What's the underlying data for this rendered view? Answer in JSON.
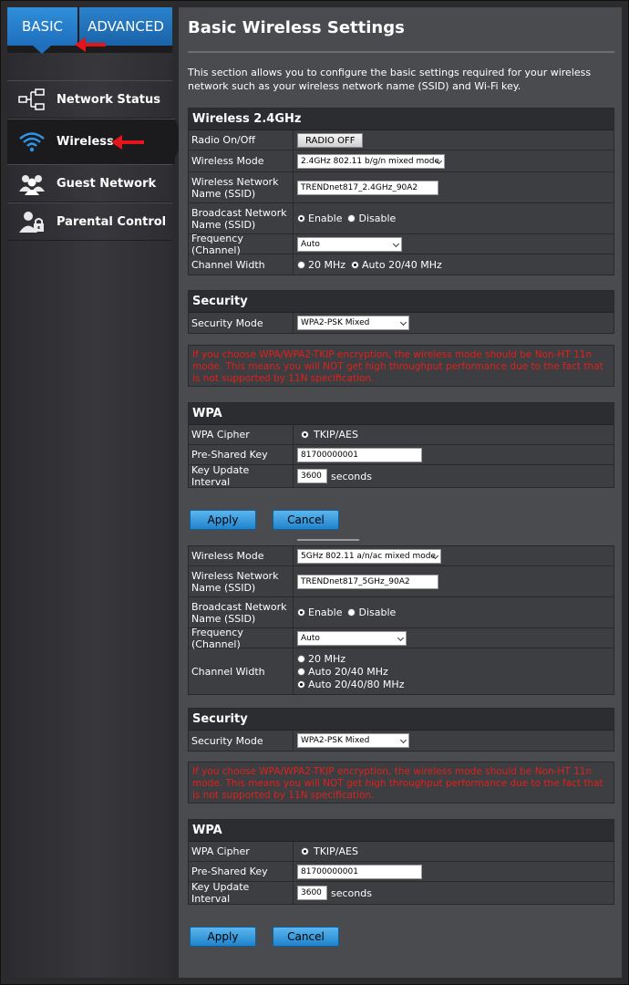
{
  "tabs": {
    "basic": "BASIC",
    "advanced": "ADVANCED"
  },
  "nav": [
    {
      "label": "Network Status",
      "icon": "network-tree-icon"
    },
    {
      "label": "Wireless",
      "icon": "wifi-icon",
      "active": true
    },
    {
      "label": "Guest Network",
      "icon": "users-icon"
    },
    {
      "label": "Parental Control",
      "icon": "user-lock-icon"
    }
  ],
  "page": {
    "title": "Basic Wireless Settings",
    "intro": "This section allows you to configure the basic settings required for your wireless network such as your wireless network name (SSID) and Wi-Fi key."
  },
  "w24": {
    "header": "Wireless 2.4GHz",
    "radio_label": "Radio On/Off",
    "radio_button": "RADIO OFF",
    "mode_label": "Wireless Mode",
    "mode_value": "2.4GHz 802.11 b/g/n mixed mode",
    "ssid_label": "Wireless Network Name (SSID)",
    "ssid_value": "TRENDnet817_2.4GHz_90A2",
    "broadcast_label": "Broadcast Network Name (SSID)",
    "enable": "Enable",
    "disable": "Disable",
    "freq_label": "Frequency (Channel)",
    "freq_value": "Auto",
    "width_label": "Channel Width",
    "width_20": "20 MHz",
    "width_auto": "Auto 20/40 MHz"
  },
  "sec1": {
    "header": "Security",
    "mode_label": "Security Mode",
    "mode_value": "WPA2-PSK Mixed"
  },
  "warning": "If you choose WPA/WPA2-TKIP encryption, the wireless mode should be Non-HT 11n mode. This means you will NOT get high throughput performance due to the fact that is not supported by 11N specification.",
  "wpa1": {
    "header": "WPA",
    "cipher_label": "WPA Cipher",
    "cipher_value": "TKIP/AES",
    "psk_label": "Pre-Shared Key",
    "psk_value": "81700000001",
    "interval_label": "Key Update Interval",
    "interval_value": "3600",
    "interval_unit": "seconds"
  },
  "buttons": {
    "apply": "Apply",
    "cancel": "Cancel"
  },
  "w5": {
    "mode_label": "Wireless Mode",
    "mode_value": "5GHz 802.11 a/n/ac mixed mode",
    "ssid_label": "Wireless Network Name (SSID)",
    "ssid_value": "TRENDnet817_5GHz_90A2",
    "broadcast_label": "Broadcast Network Name (SSID)",
    "enable": "Enable",
    "disable": "Disable",
    "freq_label": "Frequency (Channel)",
    "freq_value": "Auto",
    "width_label": "Channel Width",
    "width_20": "20 MHz",
    "width_40": "Auto 20/40 MHz",
    "width_80": "Auto 20/40/80 MHz"
  },
  "sec2": {
    "header": "Security",
    "mode_label": "Security Mode",
    "mode_value": "WPA2-PSK Mixed"
  },
  "wpa2": {
    "header": "WPA",
    "cipher_label": "WPA Cipher",
    "cipher_value": "TKIP/AES",
    "psk_label": "Pre-Shared Key",
    "psk_value": "81700000001",
    "interval_label": "Key Update Interval",
    "interval_value": "3600",
    "interval_unit": "seconds"
  },
  "colors": {
    "accent": "#1f83cc",
    "warning": "#e0201c",
    "annotation_arrow": "#e4141b"
  }
}
